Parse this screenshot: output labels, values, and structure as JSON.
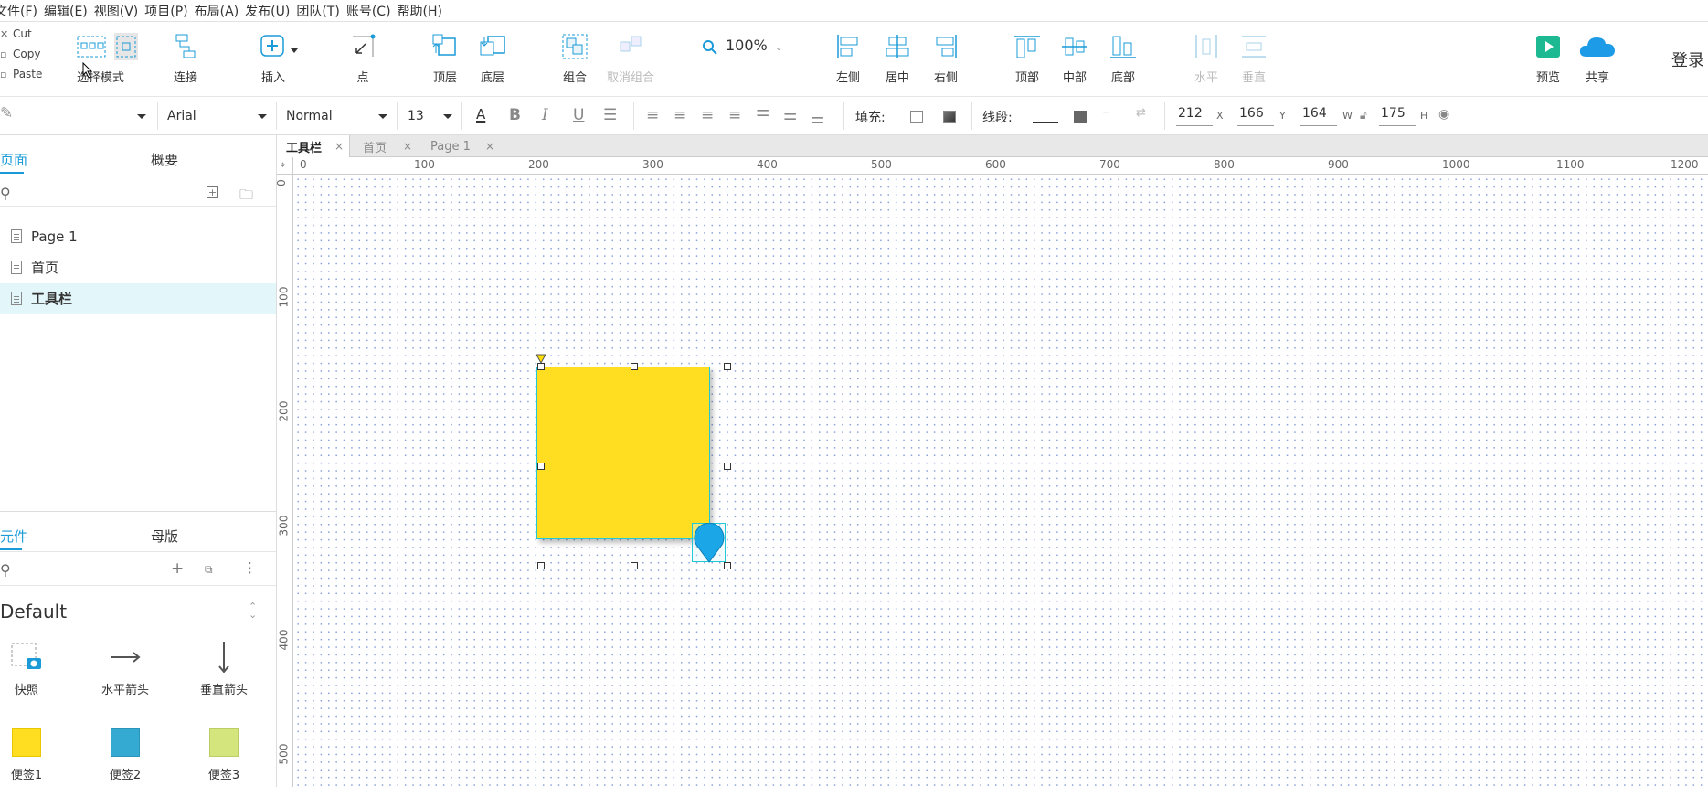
{
  "menu": [
    "文件(F)",
    "编辑(E)",
    "视图(V)",
    "项目(P)",
    "布局(A)",
    "发布(U)",
    "团队(T)",
    "账号(C)",
    "帮助(H)"
  ],
  "clipboard": {
    "cut": "Cut",
    "copy": "Copy",
    "paste": "Paste"
  },
  "toolbar": {
    "select_mode": "选择模式",
    "connect": "连接",
    "insert": "插入",
    "point": "点",
    "top_layer": "顶层",
    "bottom_layer": "底层",
    "group": "组合",
    "ungroup": "取消组合",
    "zoom": "100%",
    "align_left": "左侧",
    "align_center": "居中",
    "align_right": "右侧",
    "align_top": "顶部",
    "align_middle": "中部",
    "align_bottom": "底部",
    "dist_h": "水平",
    "dist_v": "垂直",
    "preview": "预览",
    "share": "共享",
    "login": "登录"
  },
  "format": {
    "font": "Arial",
    "style": "Normal",
    "size": "13",
    "fill_label": "填充:",
    "line_label": "线段:",
    "x": "212",
    "x_label": "X",
    "y": "166",
    "y_label": "Y",
    "w": "164",
    "w_label": "W",
    "h": "175",
    "h_label": "H"
  },
  "colors": {
    "accent": "#1a9bd7",
    "sticky_yellow": "#ffde21",
    "sticky_blue": "#34a9d2",
    "sticky_green": "#d4e57e",
    "selected_row": "#e3f6f9",
    "marker": "#1ba6e8"
  },
  "left_panel": {
    "tabs": [
      "页面",
      "概要"
    ],
    "pages": [
      "Page 1",
      "首页",
      "工具栏"
    ],
    "selected_page": "工具栏",
    "lib_tabs": [
      "元件",
      "母版"
    ],
    "library": "Default",
    "widgets": [
      "快照",
      "水平箭头",
      "垂直箭头",
      "便签1",
      "便签2",
      "便签3"
    ]
  },
  "doc_tabs": [
    "工具栏",
    "首页",
    "Page 1"
  ],
  "ruler_h": [
    "0",
    "100",
    "200",
    "300",
    "400",
    "500",
    "600",
    "700",
    "800",
    "900",
    "1000",
    "1100",
    "1200"
  ],
  "ruler_v": [
    "0",
    "100",
    "200",
    "300",
    "400",
    "500"
  ]
}
